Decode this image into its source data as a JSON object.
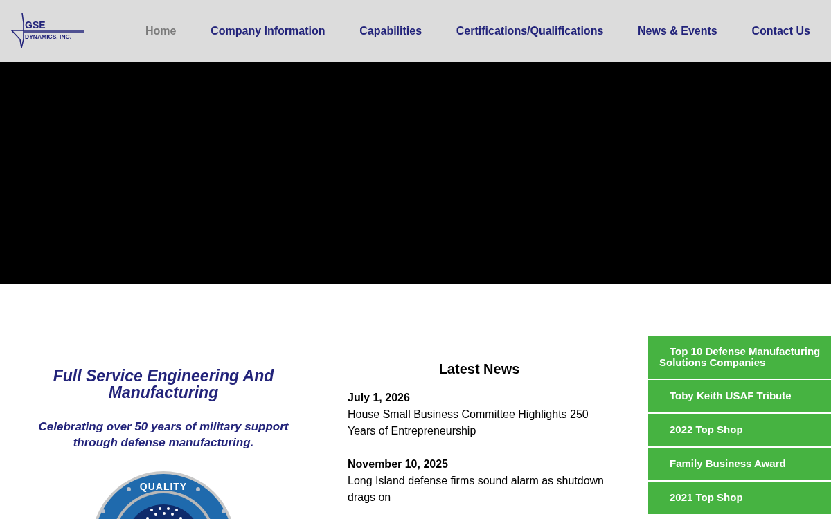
{
  "logo": {
    "name": "GSE",
    "subtitle": "DYNAMICS, INC."
  },
  "nav": [
    {
      "label": "Home",
      "selected": true
    },
    {
      "label": "Company Information",
      "selected": false
    },
    {
      "label": "Capabilities",
      "selected": false
    },
    {
      "label": "Certifications/Qualifications",
      "selected": false
    },
    {
      "label": "News & Events",
      "selected": false
    },
    {
      "label": "Contact Us",
      "selected": false
    }
  ],
  "intro": {
    "heading": "Full Service Engineering And Manufacturing",
    "tagline": "Celebrating over 50 years of military support through defense manufacturing.",
    "seal_text": "QUALITY"
  },
  "news": {
    "title": "Latest News",
    "items": [
      {
        "date": "July 1, 2026",
        "headline": "House Small Business Committee Highlights 250 Years of Entrepreneurship"
      },
      {
        "date": "November 10, 2025",
        "headline": "Long Island defense firms sound alarm as shutdown drags on"
      }
    ]
  },
  "sidebar": [
    "Top 10 Defense Manufacturing Solutions Companies",
    "Toby Keith USAF Tribute",
    "2022 Top Shop",
    "Family Business Award",
    "2021 Top Shop"
  ]
}
